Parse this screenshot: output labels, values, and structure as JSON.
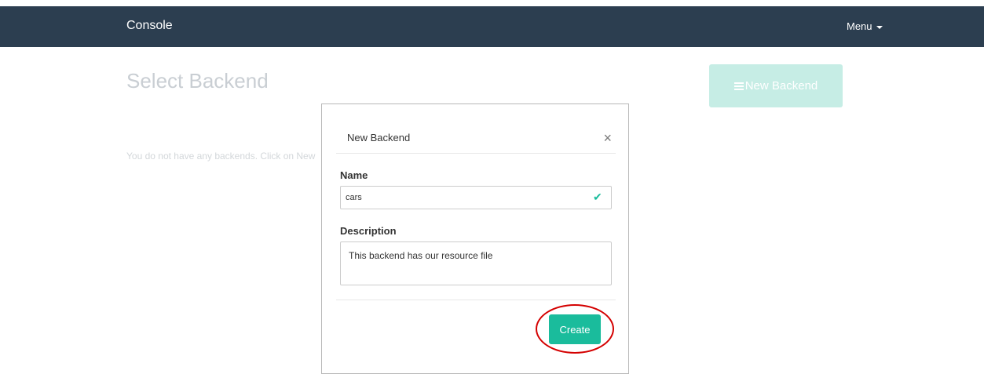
{
  "navbar": {
    "brand": "Console",
    "menu_label": "Menu"
  },
  "page": {
    "title": "Select Backend",
    "new_backend_label": "New Backend",
    "empty_message": "You do not have any backends. Click on New"
  },
  "modal": {
    "title": "New Backend",
    "close_glyph": "×",
    "name_label": "Name",
    "name_value": "cars",
    "valid_glyph": "✔",
    "description_label": "Description",
    "description_value": "This backend has our resource file",
    "create_label": "Create"
  },
  "colors": {
    "navbar": "#2c3e50",
    "accent": "#1abc9c",
    "annotation": "#d40000"
  }
}
